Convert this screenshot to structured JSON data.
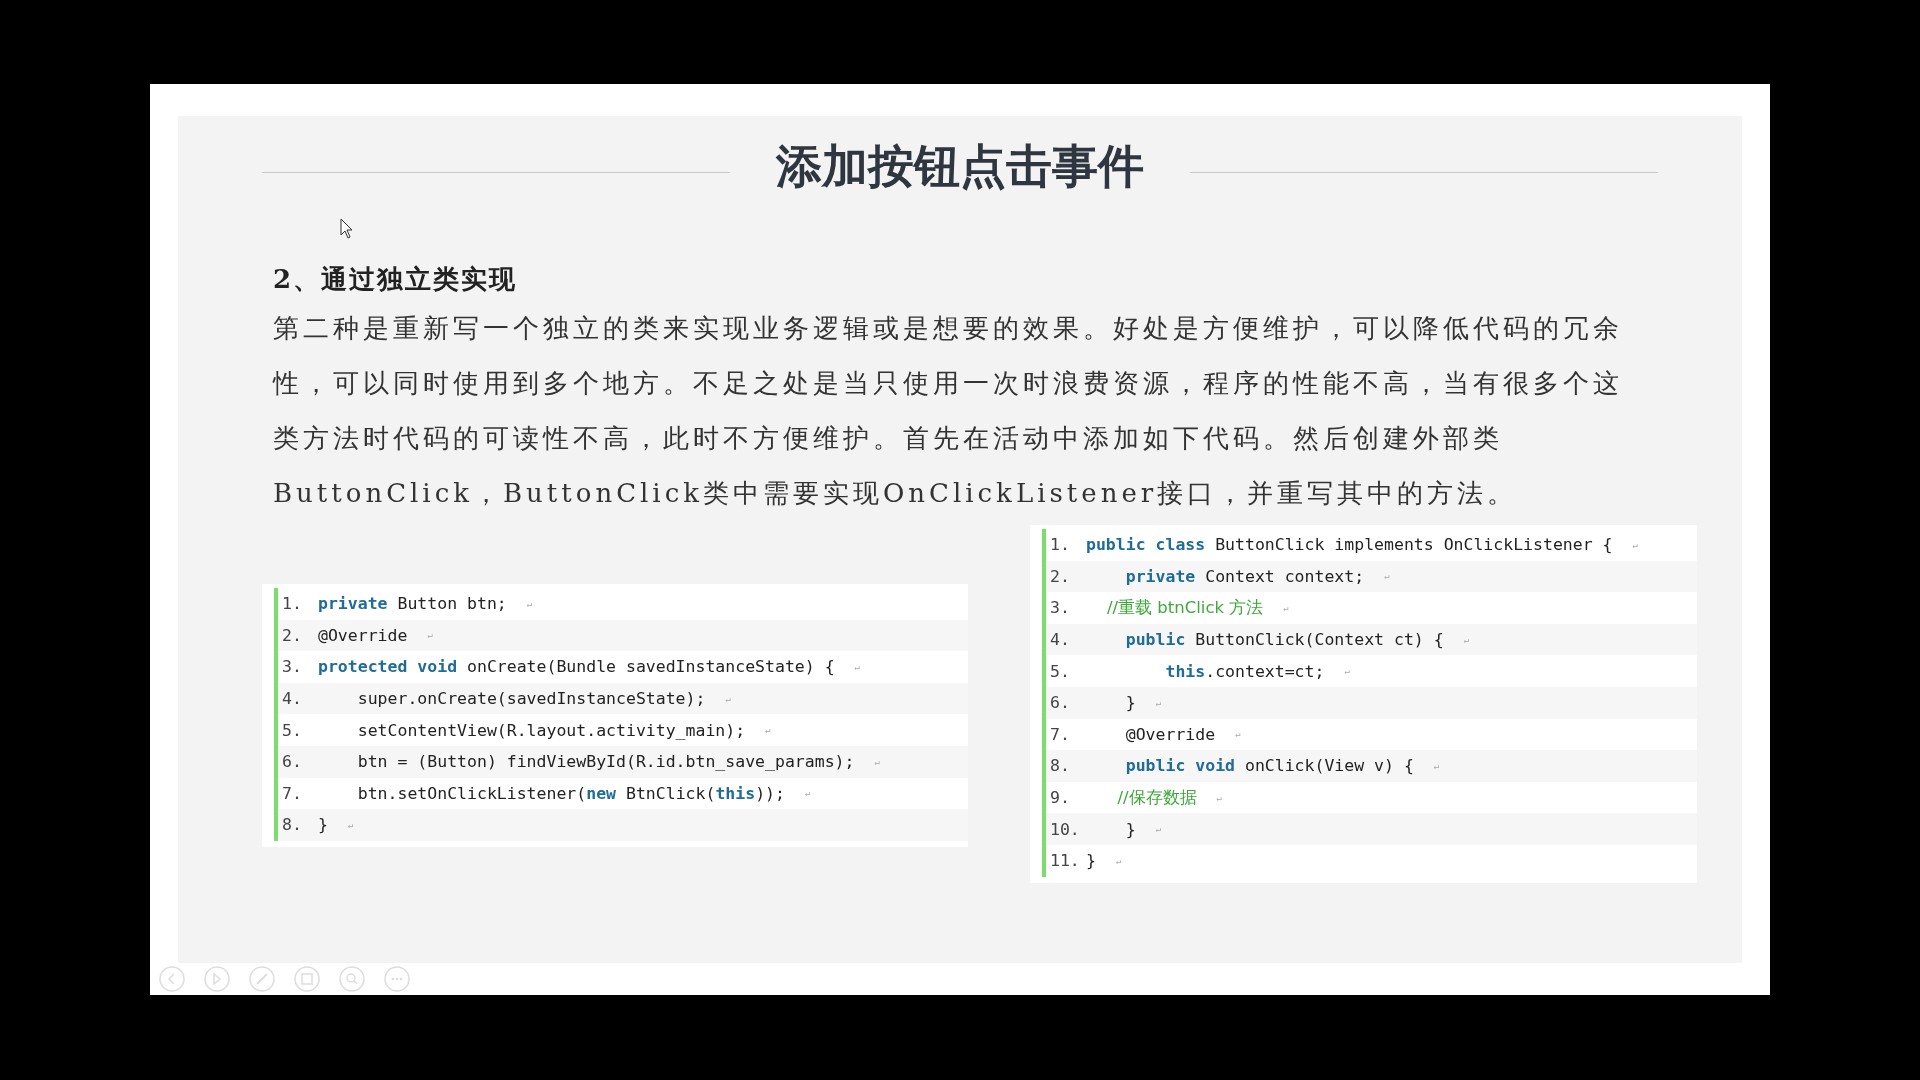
{
  "slide": {
    "title": "添加按钮点击事件",
    "subtitle": "2、通过独立类实现",
    "paragraph": "第二种是重新写一个独立的类来实现业务逻辑或是想要的效果。好处是方便维护，可以降低代码的冗余性，可以同时使用到多个地方。不足之处是当只使用一次时浪费资源，程序的性能不高，当有很多个这类方法时代码的可读性不高，此时不方便维护。首先在活动中添加如下代码。然后创建外部类ButtonClick，ButtonClick类中需要实现OnClickListener接口，并重写其中的方法。",
    "code_blocks": [
      {
        "lines": [
          {
            "number": "1.",
            "tokens": [
              {
                "kind": "keyword",
                "text": "private"
              },
              {
                "kind": "plain",
                "text": " Button btn;"
              }
            ],
            "end_mark": "↵"
          },
          {
            "number": "2.",
            "tokens": [
              {
                "kind": "plain",
                "text": "@Override"
              }
            ],
            "end_mark": "↵"
          },
          {
            "number": "3.",
            "tokens": [
              {
                "kind": "keyword",
                "text": "protected void"
              },
              {
                "kind": "plain",
                "text": " onCreate(Bundle savedInstanceState) {"
              }
            ],
            "end_mark": "↵"
          },
          {
            "number": "4.",
            "tokens": [
              {
                "kind": "plain",
                "text": "    super.onCreate(savedInstanceState);"
              }
            ],
            "end_mark": "↵"
          },
          {
            "number": "5.",
            "tokens": [
              {
                "kind": "plain",
                "text": "    setContentView(R.layout.activity_main);"
              }
            ],
            "end_mark": "↵"
          },
          {
            "number": "6.",
            "tokens": [
              {
                "kind": "plain",
                "text": "    btn = (Button) findViewById(R.id.btn_save_params);"
              }
            ],
            "end_mark": "↵"
          },
          {
            "number": "7.",
            "tokens": [
              {
                "kind": "plain",
                "text": "    btn.setOnClickListener("
              },
              {
                "kind": "keyword",
                "text": "new"
              },
              {
                "kind": "plain",
                "text": " BtnClick("
              },
              {
                "kind": "keyword",
                "text": "this"
              },
              {
                "kind": "plain",
                "text": "));"
              }
            ],
            "end_mark": "↵"
          },
          {
            "number": "8.",
            "tokens": [
              {
                "kind": "plain",
                "text": "}"
              }
            ],
            "end_mark": "↵"
          }
        ]
      },
      {
        "lines": [
          {
            "number": "1.",
            "tokens": [
              {
                "kind": "keyword",
                "text": "public class"
              },
              {
                "kind": "plain",
                "text": " ButtonClick implements OnClickListener {"
              }
            ],
            "end_mark": "↵"
          },
          {
            "number": "2.",
            "tokens": [
              {
                "kind": "keyword",
                "text": "    private"
              },
              {
                "kind": "plain",
                "text": " Context context;"
              }
            ],
            "end_mark": "↵"
          },
          {
            "number": "3.",
            "tokens": [
              {
                "kind": "comment",
                "text": "    //重载 btnClick 方法"
              }
            ],
            "end_mark": "↵"
          },
          {
            "number": "4.",
            "tokens": [
              {
                "kind": "keyword",
                "text": "    public"
              },
              {
                "kind": "plain",
                "text": " ButtonClick(Context ct) {"
              }
            ],
            "end_mark": "↵"
          },
          {
            "number": "5.",
            "tokens": [
              {
                "kind": "keyword",
                "text": "        this"
              },
              {
                "kind": "plain",
                "text": ".context=ct;"
              }
            ],
            "end_mark": "↵"
          },
          {
            "number": "6.",
            "tokens": [
              {
                "kind": "plain",
                "text": "    }"
              }
            ],
            "end_mark": "↵"
          },
          {
            "number": "7.",
            "tokens": [
              {
                "kind": "plain",
                "text": "    @Override"
              }
            ],
            "end_mark": "↵"
          },
          {
            "number": "8.",
            "tokens": [
              {
                "kind": "keyword",
                "text": "    public void"
              },
              {
                "kind": "plain",
                "text": " onClick(View v) {"
              }
            ],
            "end_mark": "↵"
          },
          {
            "number": "9.",
            "tokens": [
              {
                "kind": "comment",
                "text": "      //保存数据"
              }
            ],
            "end_mark": "↵"
          },
          {
            "number": "10.",
            "tokens": [
              {
                "kind": "plain",
                "text": "    }"
              }
            ],
            "end_mark": "↵"
          },
          {
            "number": "11.",
            "tokens": [
              {
                "kind": "plain",
                "text": "}"
              }
            ],
            "end_mark": "↵"
          }
        ]
      }
    ]
  }
}
